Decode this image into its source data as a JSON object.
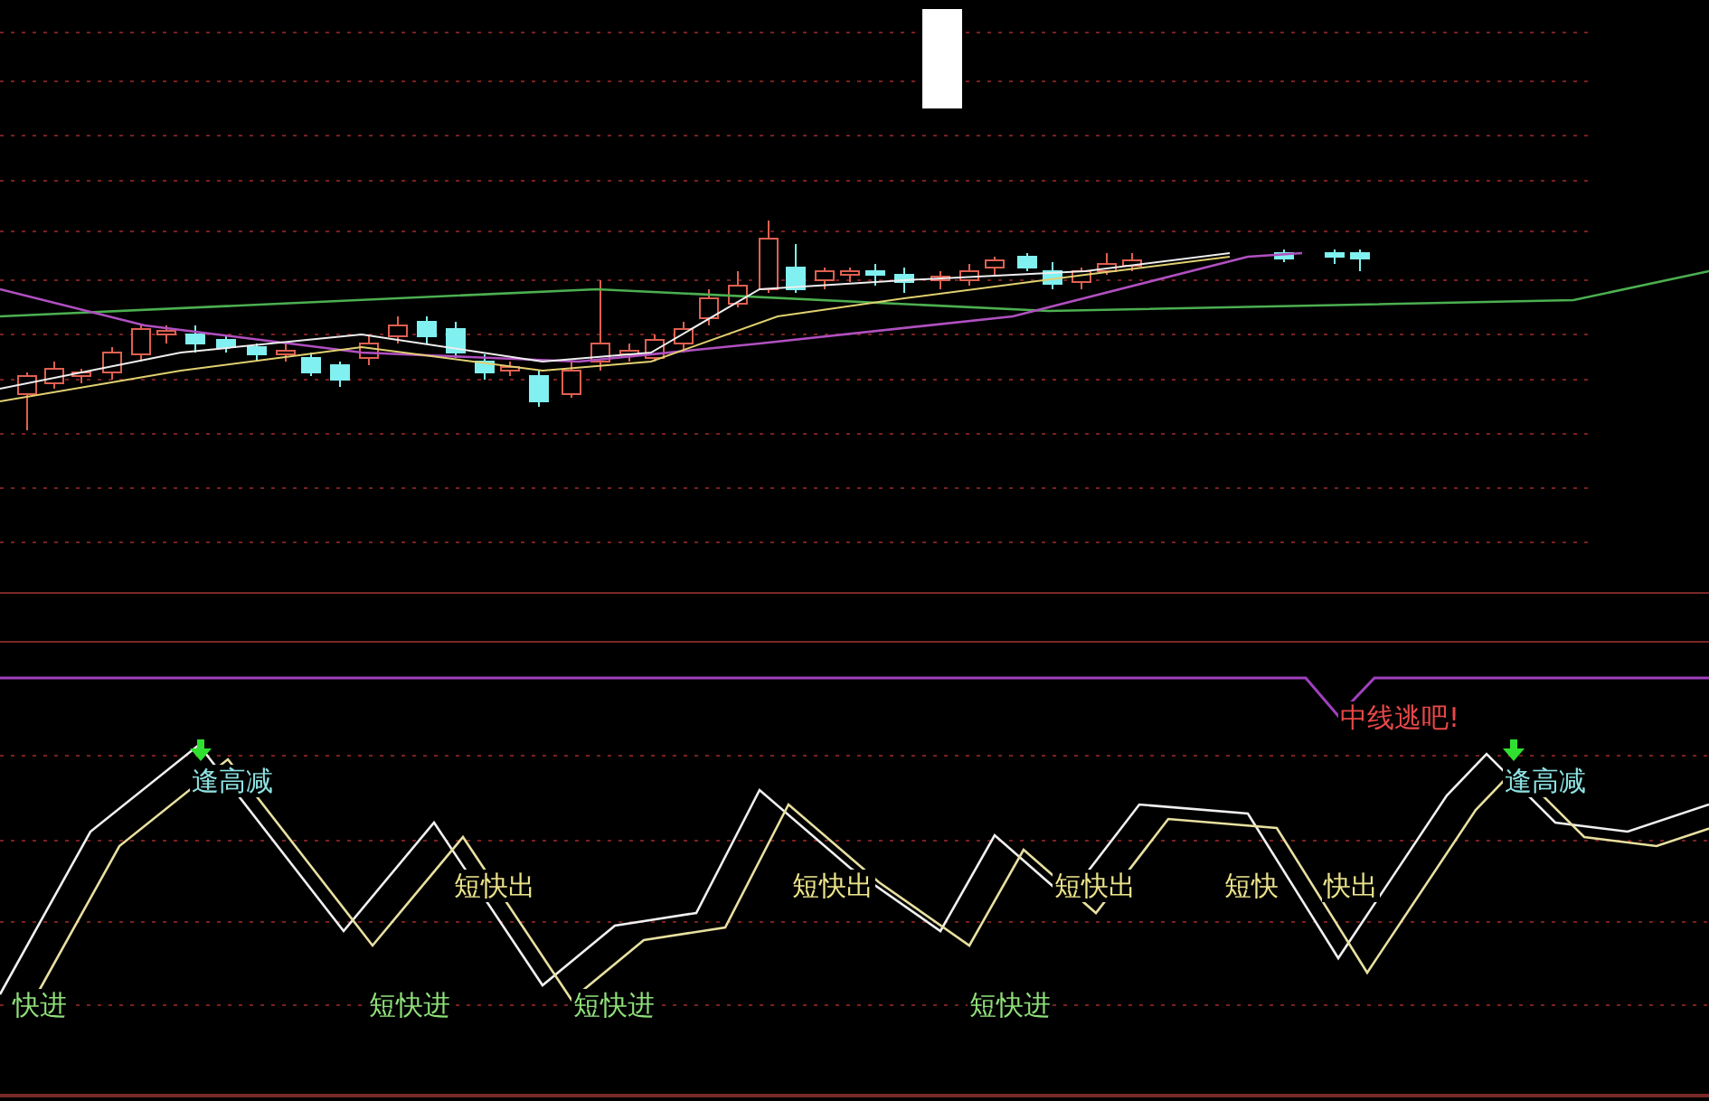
{
  "signals": [
    {
      "kind": "sell_high",
      "text": "逢高减"
    },
    {
      "kind": "quick_out",
      "text": "短快出"
    },
    {
      "kind": "quick_out",
      "text": "短快出"
    },
    {
      "kind": "quick_out",
      "text": "短快出"
    },
    {
      "kind": "quick_out",
      "text": "短快"
    },
    {
      "kind": "quick_out",
      "text": "快出"
    },
    {
      "kind": "quick_in",
      "text": "快进"
    },
    {
      "kind": "quick_in",
      "text": "短快进"
    },
    {
      "kind": "quick_in",
      "text": "短快进"
    },
    {
      "kind": "quick_in",
      "text": "短快进"
    },
    {
      "kind": "mid_escape",
      "text": "中线逃吧!"
    },
    {
      "kind": "sell_high",
      "text": "逢高减"
    }
  ]
}
